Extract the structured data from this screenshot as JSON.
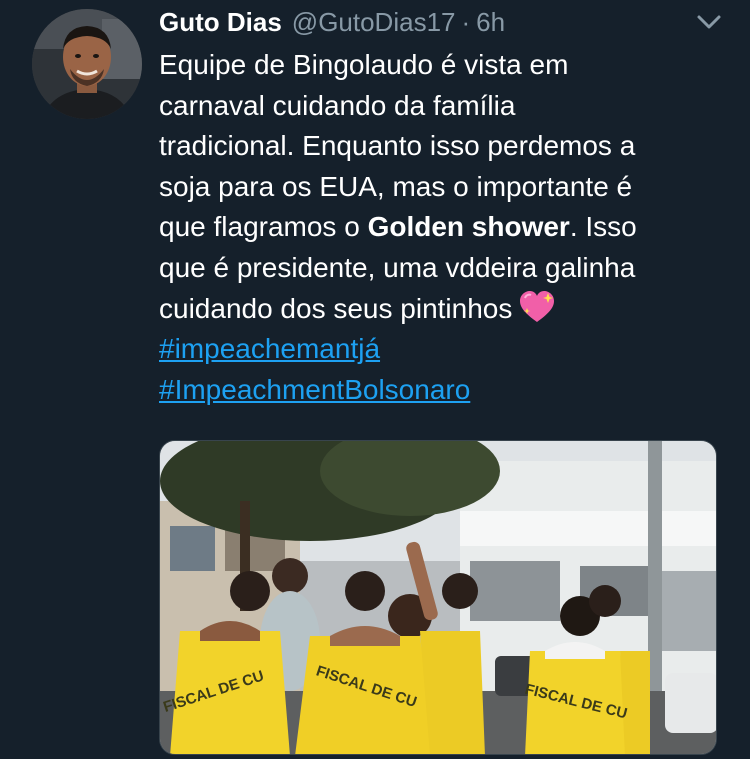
{
  "user": {
    "display_name": "Guto Dias",
    "handle": "@GutoDias17",
    "separator": "·",
    "time": "6h"
  },
  "icons": {
    "avatar": "profile-photo",
    "menu": "chevron-down-icon",
    "emoji": "sparkling-heart-icon"
  },
  "tweet": {
    "line1": "Equipe de Bingolaudo é vista em",
    "line2": "carnaval cuidando da família",
    "line3": "tradicional. Enquanto isso perdemos a",
    "line4": "soja para os EUA, mas o importante é",
    "line5_pre": "que flagramos o ",
    "line5_bold": "Golden shower",
    "line5_post": ". Isso",
    "line6": "que é presidente, uma vddeira galinha",
    "line7": "cuidando dos seus pintinhos",
    "hashtags": [
      "#impeachemantjá",
      "#ImpeachmentBolsonaro"
    ]
  },
  "media": {
    "vest_text_1": "FISCAL DE CU",
    "vest_text_2": "FISCAL DE CU",
    "vest_text_3": "FISCAL DE CU"
  },
  "colors": {
    "background": "#15202b",
    "text": "#ffffff",
    "secondary": "#8899a6",
    "link": "#1da1f2",
    "vest": "#f2d32a"
  }
}
